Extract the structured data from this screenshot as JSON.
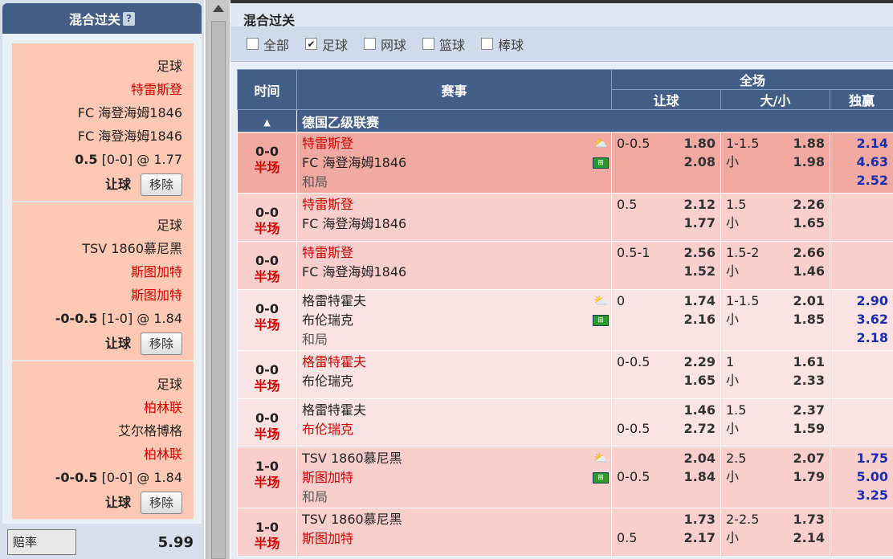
{
  "left_panel": {
    "title": "混合过关",
    "help": "?",
    "cards": [
      {
        "sport": "足球",
        "lines": [
          {
            "text": "特雷斯登",
            "red": true
          },
          {
            "text": "FC 海登海姆1846",
            "red": false
          },
          {
            "text": "FC 海登海姆1846",
            "red": false
          }
        ],
        "odds_bold": "0.5",
        "odds_rest": " [0-0] @ 1.77",
        "bet_type": "让球",
        "remove": "移除"
      },
      {
        "sport": "足球",
        "lines": [
          {
            "text": "TSV 1860慕尼黑",
            "red": false
          },
          {
            "text": "斯图加特",
            "red": true
          },
          {
            "text": "斯图加特",
            "red": true
          }
        ],
        "odds_bold": "-0-0.5",
        "odds_rest": " [1-0] @ 1.84",
        "bet_type": "让球",
        "remove": "移除"
      },
      {
        "sport": "足球",
        "lines": [
          {
            "text": "柏林联",
            "red": true
          },
          {
            "text": "艾尔格博格",
            "red": false
          },
          {
            "text": "柏林联",
            "red": true
          }
        ],
        "odds_bold": "-0-0.5",
        "odds_rest": " [0-0] @ 1.84",
        "bet_type": "让球",
        "remove": "移除"
      }
    ],
    "payout_label": "赔率",
    "payout_value": "5.99"
  },
  "main": {
    "title": "混合过关",
    "filters": [
      {
        "label": "全部",
        "checked": false
      },
      {
        "label": "足球",
        "checked": true
      },
      {
        "label": "网球",
        "checked": false
      },
      {
        "label": "篮球",
        "checked": false
      },
      {
        "label": "棒球",
        "checked": false
      }
    ],
    "headers": {
      "time": "时间",
      "event": "赛事",
      "full": "全场",
      "handicap": "让球",
      "ou": "大/小",
      "win": "独赢"
    },
    "league": "德国乙级联赛",
    "league_arrow": "▲",
    "rows": [
      {
        "style": "dark",
        "score": "0-0",
        "half": "半场",
        "teams": [
          {
            "t": "特雷斯登",
            "c": "red"
          },
          {
            "t": "FC 海登海姆1846",
            "c": ""
          },
          {
            "t": "和局",
            "c": "gray"
          }
        ],
        "icons": true,
        "h1": "0-0.5",
        "h1v": "1.80",
        "h2": "",
        "h2v": "2.08",
        "o1": "1-1.5",
        "o1v": "1.88",
        "o2": "小",
        "o2v": "1.98",
        "w": [
          "2.14",
          "4.63",
          "2.52"
        ]
      },
      {
        "style": "pink",
        "score": "0-0",
        "half": "半场",
        "teams": [
          {
            "t": "特雷斯登",
            "c": "red"
          },
          {
            "t": "FC 海登海姆1846",
            "c": ""
          }
        ],
        "icons": false,
        "h1": "0.5",
        "h1v": "2.12",
        "h2": "",
        "h2v": "1.77",
        "o1": "1.5",
        "o1v": "2.26",
        "o2": "小",
        "o2v": "1.65",
        "w": []
      },
      {
        "style": "pink",
        "score": "0-0",
        "half": "半场",
        "teams": [
          {
            "t": "特雷斯登",
            "c": "red"
          },
          {
            "t": "FC 海登海姆1846",
            "c": ""
          }
        ],
        "icons": false,
        "h1": "0.5-1",
        "h1v": "2.56",
        "h2": "",
        "h2v": "1.52",
        "o1": "1.5-2",
        "o1v": "2.66",
        "o2": "小",
        "o2v": "1.46",
        "w": []
      },
      {
        "style": "light",
        "score": "0-0",
        "half": "半场",
        "teams": [
          {
            "t": "格雷特霍夫",
            "c": ""
          },
          {
            "t": "布伦瑞克",
            "c": ""
          },
          {
            "t": "和局",
            "c": "gray"
          }
        ],
        "icons": true,
        "h1": "0",
        "h1v": "1.74",
        "h2": "",
        "h2v": "2.16",
        "o1": "1-1.5",
        "o1v": "2.01",
        "o2": "小",
        "o2v": "1.85",
        "w": [
          "2.90",
          "3.62",
          "2.18"
        ]
      },
      {
        "style": "light",
        "score": "0-0",
        "half": "半场",
        "teams": [
          {
            "t": "格雷特霍夫",
            "c": "red"
          },
          {
            "t": "布伦瑞克",
            "c": ""
          }
        ],
        "icons": false,
        "h1": "0-0.5",
        "h1v": "2.29",
        "h2": "",
        "h2v": "1.65",
        "o1": "1",
        "o1v": "1.61",
        "o2": "小",
        "o2v": "2.33",
        "w": []
      },
      {
        "style": "light",
        "score": "0-0",
        "half": "半场",
        "teams": [
          {
            "t": "格雷特霍夫",
            "c": ""
          },
          {
            "t": "布伦瑞克",
            "c": "red"
          }
        ],
        "icons": false,
        "h1": "",
        "h1v": "1.46",
        "h2": "0-0.5",
        "h2v": "2.72",
        "o1": "1.5",
        "o1v": "2.37",
        "o2": "小",
        "o2v": "1.59",
        "w": []
      },
      {
        "style": "pink",
        "score": "1-0",
        "half": "半场",
        "teams": [
          {
            "t": "TSV 1860慕尼黑",
            "c": ""
          },
          {
            "t": "斯图加特",
            "c": "red"
          },
          {
            "t": "和局",
            "c": "gray"
          }
        ],
        "icons": true,
        "h1": "",
        "h1v": "2.04",
        "h2": "0-0.5",
        "h2v": "1.84",
        "o1": "2.5",
        "o1v": "2.07",
        "o2": "小",
        "o2v": "1.79",
        "w": [
          "1.75",
          "5.00",
          "3.25"
        ]
      },
      {
        "style": "pink",
        "score": "1-0",
        "half": "半场",
        "teams": [
          {
            "t": "TSV 1860慕尼黑",
            "c": ""
          },
          {
            "t": "斯图加特",
            "c": "red"
          }
        ],
        "icons": false,
        "h1": "",
        "h1v": "1.73",
        "h2": "0.5",
        "h2v": "2.17",
        "o1": "2-2.5",
        "o1v": "1.73",
        "o2": "小",
        "o2v": "2.14",
        "w": []
      }
    ]
  },
  "colors": {
    "header_blue": "#445f87",
    "red_text": "#d40000",
    "blue_odds": "#1a2fb0",
    "slip_bg": "#fdc8b4"
  },
  "icons": {
    "weather": "sun-cloud-icon",
    "field": "soccer-field-icon"
  }
}
